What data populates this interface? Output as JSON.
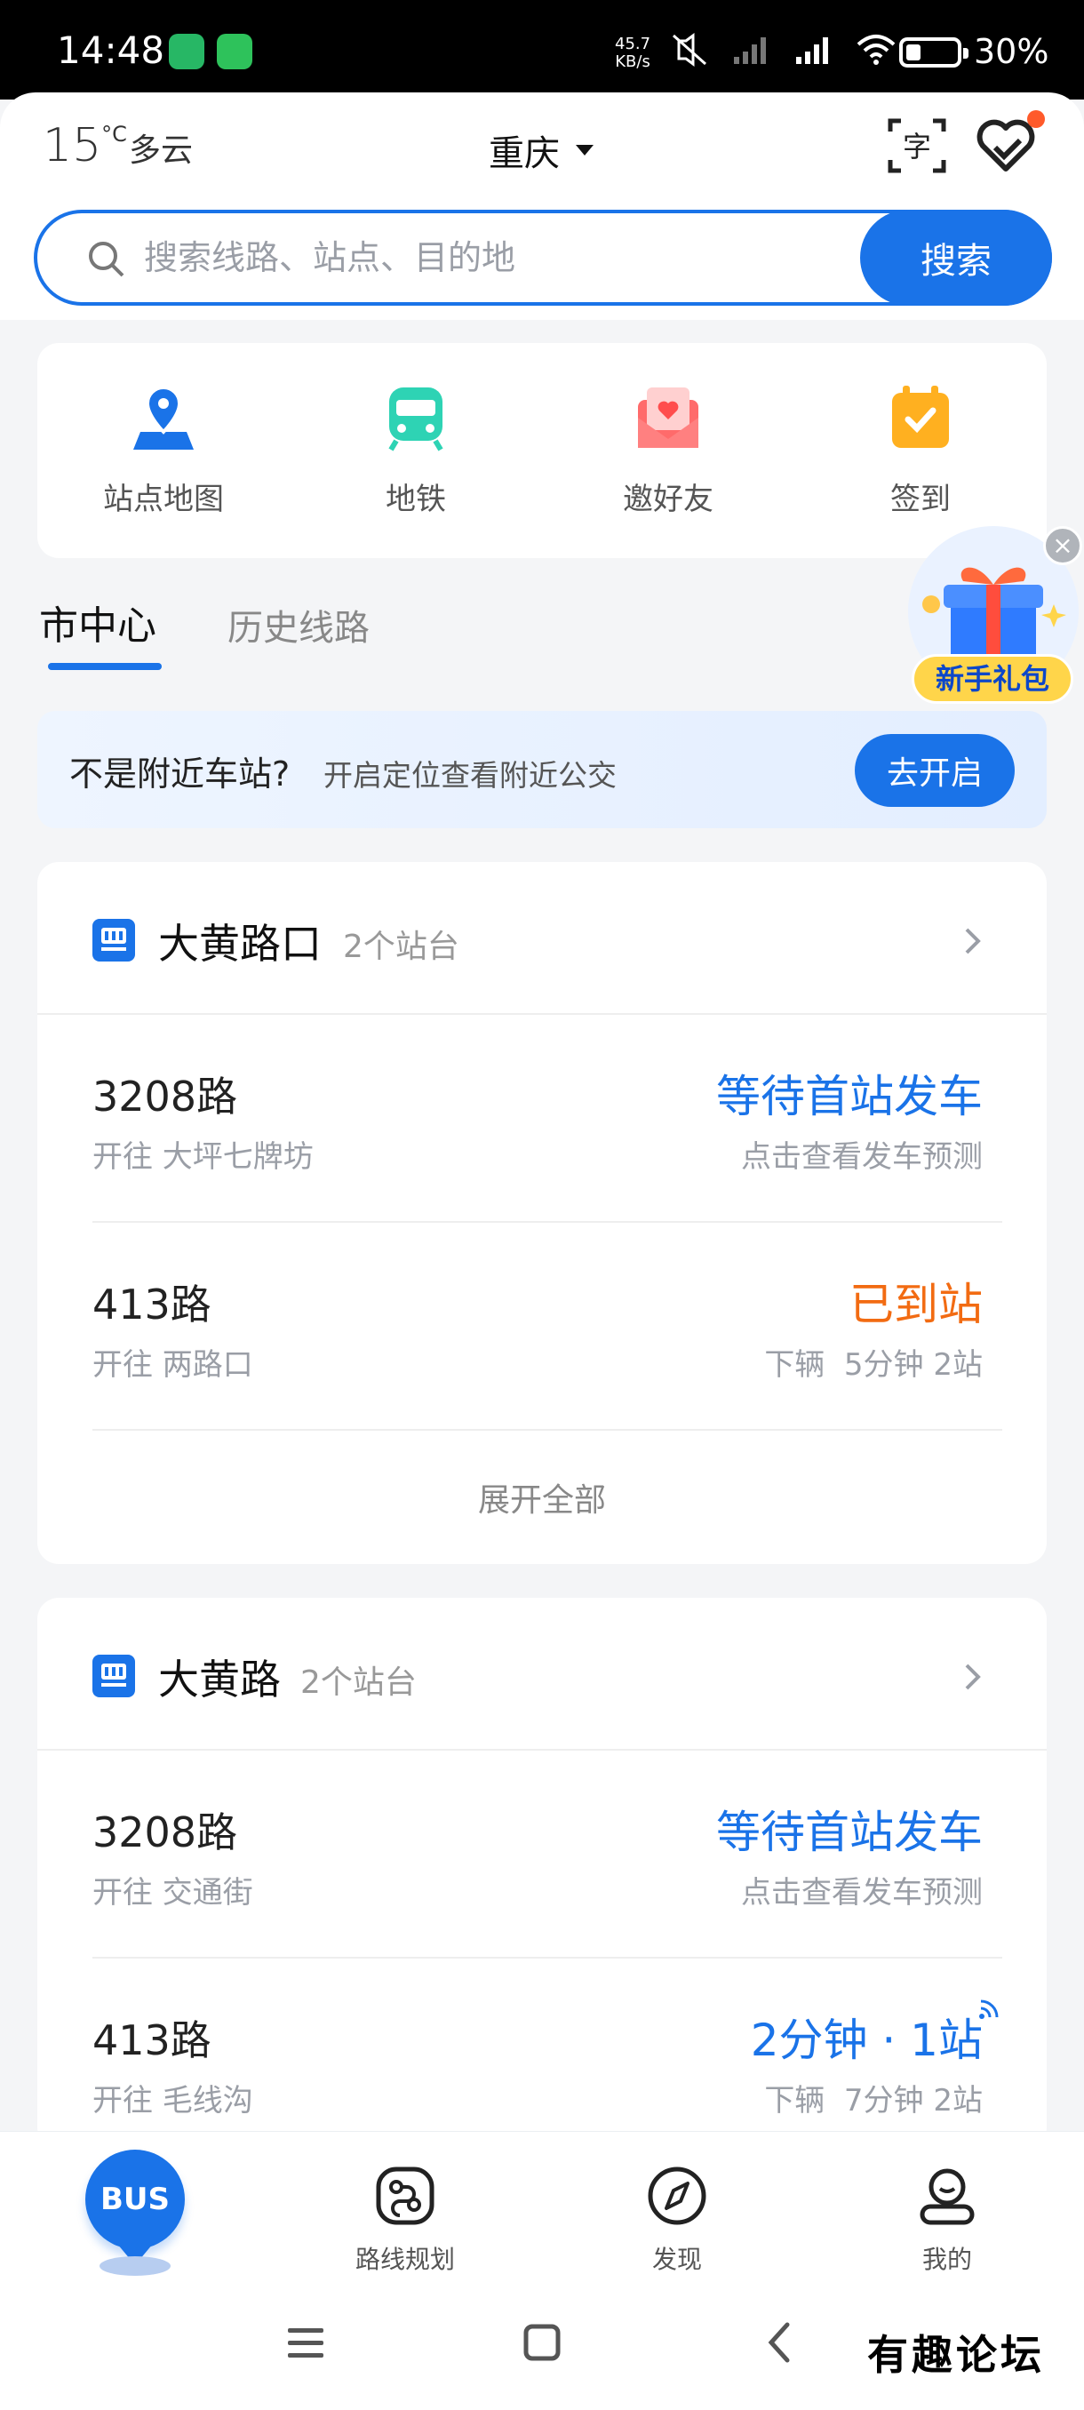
{
  "status_bar": {
    "time": "14:48",
    "net_speed_value": "45.7",
    "net_speed_unit": "KB/s",
    "battery": "30%"
  },
  "header": {
    "temperature": "15",
    "temperature_unit": "°C",
    "weather": "多云",
    "city": "重庆"
  },
  "search": {
    "placeholder": "搜索线路、站点、目的地",
    "button": "搜索"
  },
  "shortcuts": [
    {
      "label": "站点地图",
      "icon": "map-pin-icon",
      "color": "#1a73e8"
    },
    {
      "label": "地铁",
      "icon": "subway-icon",
      "color": "#2ed3b4"
    },
    {
      "label": "邀好友",
      "icon": "invite-envelope-icon",
      "color": "#ff6b6b"
    },
    {
      "label": "签到",
      "icon": "calendar-check-icon",
      "color": "#ffb020"
    }
  ],
  "gift": {
    "label": "新手礼包"
  },
  "tabs": {
    "active": "市中心",
    "inactive": "历史线路"
  },
  "location_banner": {
    "main": "不是附近车站?",
    "sub": "开启定位查看附近公交",
    "button": "去开启"
  },
  "stations": [
    {
      "name": "大黄路口",
      "count": "2个站台",
      "routes": [
        {
          "number": "3208路",
          "direction": "开往 大坪七牌坊",
          "status": "等待首站发车",
          "status_color": "#1a73e8",
          "sub": "点击查看发车预测"
        },
        {
          "number": "413路",
          "direction": "开往 两路口",
          "status": "已到站",
          "status_color": "#f26b12",
          "sub": "下辆  5分钟 2站"
        }
      ],
      "expand": "展开全部"
    },
    {
      "name": "大黄路",
      "count": "2个站台",
      "routes": [
        {
          "number": "3208路",
          "direction": "开往 交通街",
          "status": "等待首站发车",
          "status_color": "#1a73e8",
          "sub": "点击查看发车预测"
        },
        {
          "number": "413路",
          "direction": "开往 毛线沟",
          "status": "2分钟 · 1站",
          "status_color": "#1a73e8",
          "sub": "下辆  7分钟 2站"
        }
      ]
    }
  ],
  "bottom_nav": {
    "bus": "BUS",
    "items": [
      "路线规划",
      "发现",
      "我的"
    ]
  },
  "watermark": "有趣论坛"
}
